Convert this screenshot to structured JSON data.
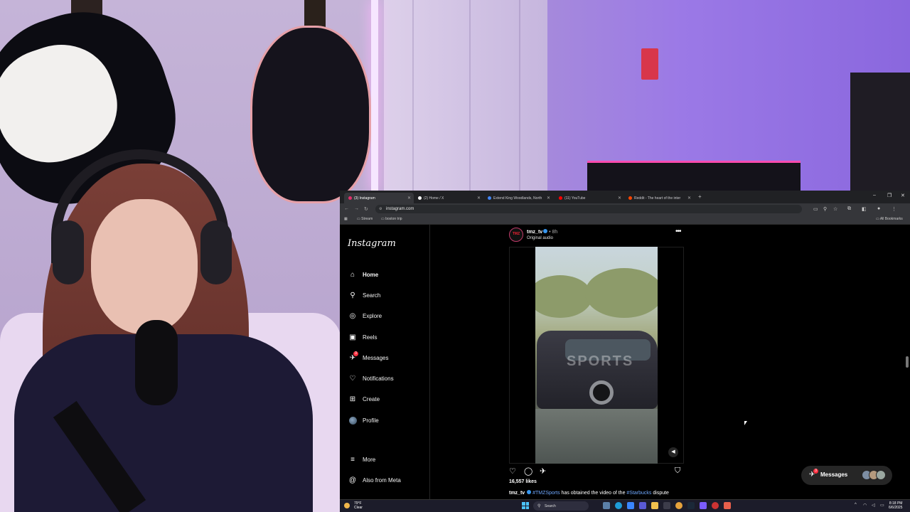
{
  "browser": {
    "tabs": [
      {
        "label": "(3) Instagram",
        "color": "#e1306c",
        "active": true
      },
      {
        "label": "(2) Home / X",
        "color": "#ffffff",
        "active": false
      },
      {
        "label": "Extend King Woodlands, North",
        "color": "#4285f4",
        "active": false
      },
      {
        "label": "(11) YouTube",
        "color": "#ff0000",
        "active": false
      },
      {
        "label": "Reddit - The heart of the inter",
        "color": "#ff4500",
        "active": false
      }
    ],
    "new_tab": "+",
    "url": "instagram.com",
    "bookmarks": [
      "Stream",
      "boston trip"
    ],
    "all_bookmarks": "All Bookmarks"
  },
  "instagram": {
    "logo": "Instagram",
    "nav": [
      {
        "label": "Home",
        "icon": "home-icon",
        "glyph": "⌂"
      },
      {
        "label": "Search",
        "icon": "search-icon",
        "glyph": "⚲"
      },
      {
        "label": "Explore",
        "icon": "compass-icon",
        "glyph": "◎"
      },
      {
        "label": "Reels",
        "icon": "reels-icon",
        "glyph": "▣"
      },
      {
        "label": "Messages",
        "icon": "messenger-icon",
        "glyph": "✈",
        "badge": "3"
      },
      {
        "label": "Notifications",
        "icon": "heart-icon",
        "glyph": "♡"
      },
      {
        "label": "Create",
        "icon": "plus-icon",
        "glyph": "⊞"
      },
      {
        "label": "Profile",
        "icon": "avatar-icon",
        "glyph": ""
      }
    ],
    "more": "More",
    "also_from_meta": "Also from Meta",
    "post": {
      "avatar_text": "TMZ",
      "username": "tmz_tv",
      "time": "• 8h",
      "audio": "Original audio",
      "more": "•••",
      "watermark": "SPORTS",
      "likes": "16,557 likes",
      "caption_user": "tmz_tv",
      "caption_tag1": "#TMZSports",
      "caption_mid": " has obtained the video of the ",
      "caption_tag2": "#Starbucks",
      "caption_end": " dispute"
    },
    "messages": {
      "label": "Messages",
      "badge": "3"
    }
  },
  "taskbar": {
    "weather_temp": "79°F",
    "weather_desc": "Clear",
    "search": "Search",
    "time": "8:18 PM",
    "date": "6/6/2025"
  },
  "colors": {
    "ig_background": "#000000",
    "link_blue": "#6fa8ff",
    "badge_red": "#ff3040",
    "verified_blue": "#3897f0"
  }
}
